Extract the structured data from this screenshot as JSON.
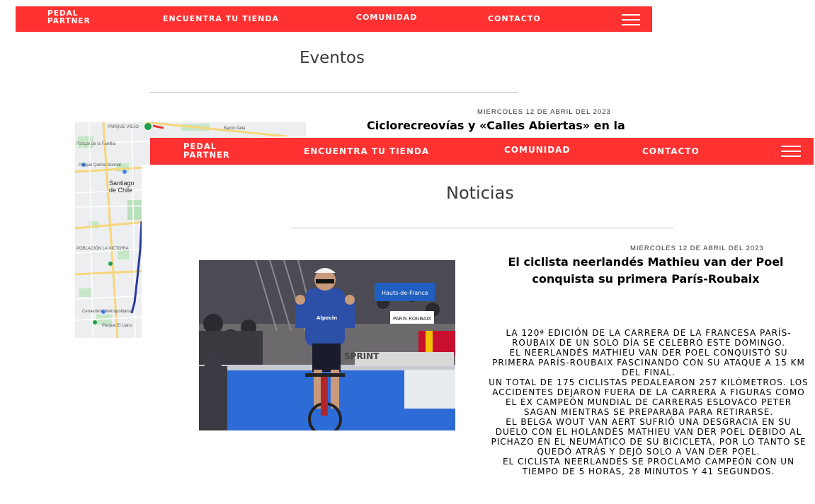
{
  "nav": {
    "brand_line1": "PEDAL",
    "brand_line2": "PARTNER",
    "links": [
      "ENCUENTRA TU TIENDA",
      "COMUNIDAD",
      "CONTACTO"
    ],
    "menu_icon": "hamburger-menu-icon",
    "color": "#ff3131"
  },
  "events_page": {
    "title": "Eventos",
    "date": "MIERCOLES 12 DE ABRIL DEL 2023",
    "headline": "Ciclorecreovías y «Calles Abiertas» en la",
    "map": {
      "city": "Santiago de Chile",
      "labels": [
        "PARQUE VIEJO",
        "Parque de la Familia",
        "Parque Quinta Normal",
        "Barrio Italia",
        "POBLACIÓN LA VICTORIA",
        "Cementerio Metropolitano",
        "Parque El Llano"
      ]
    }
  },
  "news_page": {
    "title": "Noticias",
    "date": "MIERCOLES 12 DE ABRIL DEL 2023",
    "headline": "El ciclista neerlandés Mathieu van der Poel conquista su primera París-Roubaix",
    "photo": {
      "banner_text": "Hauts-de-France",
      "sign_text": "PARIS ROUBAIX",
      "jersey_text": "Alpecin",
      "sponsor_text": "SPRINT"
    },
    "body": [
      "La 120ª edición de la carrera de la francesa París-Roubaix de un solo día se celebró este domingo.",
      "El neerlandés Mathieu van der Poel conquistó su primera París-Roubaix fascinando con su ataque a 15 km del final.",
      "Un total de 175 ciclistas pedalearon 257 kilómetros. Los accidentes dejaron fuera de la carrera a figuras como el ex campeón mundial de carreras eslovaco Peter Sagan mientras se preparaba para retirarse.",
      "El belga Wout van Aert sufrió una desgracia en su duelo con el holandés Mathieu van der Poel debido al pichazo en el neumático de su bicicleta, por lo tanto se quedó atrás y dejó solo a van der Poel.",
      "El ciclista neerlandés se proclamó campeón con un tiempo de 5 horas, 28 minutos y 41 segundos."
    ]
  }
}
